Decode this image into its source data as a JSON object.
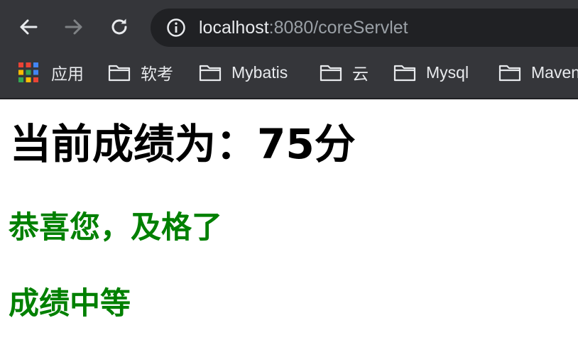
{
  "browser": {
    "url_host": "localhost",
    "url_rest": ":8080/coreServlet",
    "colors": {
      "frame": "#35363a",
      "omnibox": "#202124",
      "text": "#e8eaed",
      "text_dim": "#9aa0a6"
    }
  },
  "bookmarks": [
    {
      "icon": "apps-grid-icon",
      "label": "应用"
    },
    {
      "icon": "folder-icon",
      "label": "软考"
    },
    {
      "icon": "folder-icon",
      "label": "Mybatis"
    },
    {
      "icon": "folder-icon",
      "label": "云"
    },
    {
      "icon": "folder-icon",
      "label": "Mysql"
    },
    {
      "icon": "folder-icon",
      "label": "Maven"
    }
  ],
  "page": {
    "score_text": "当前成绩为：75分",
    "pass_message": "恭喜您，及格了",
    "grade_message": "成绩中等",
    "colors": {
      "heading": "#000000",
      "message": "#008000"
    }
  }
}
